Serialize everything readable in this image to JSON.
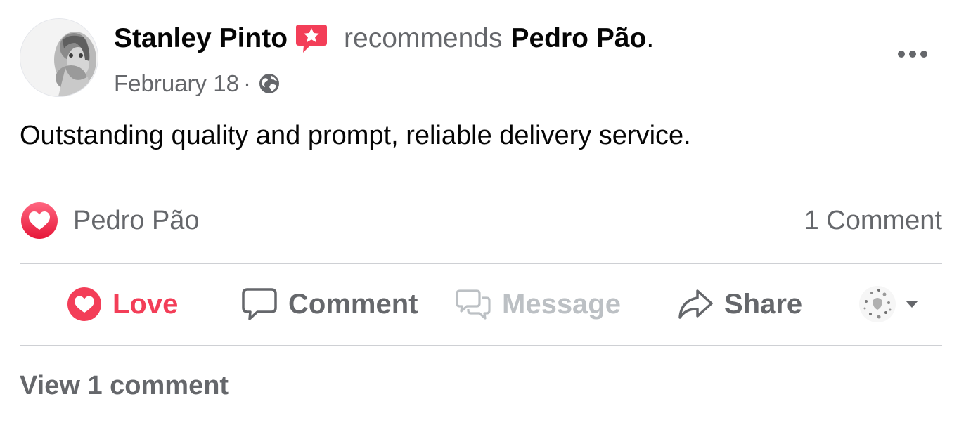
{
  "post": {
    "author": {
      "name": "Stanley Pinto",
      "avatar_icon": "profile-photo"
    },
    "recommendation": {
      "badge_icon": "recommendation-star-badge-icon",
      "badge_color": "#f33e58",
      "verb": "recommends",
      "page_name": "Pedro Pão",
      "punctuation": "."
    },
    "date": "February 18",
    "separator": "·",
    "audience_icon": "globe-icon",
    "more_icon": "more-options-icon",
    "text": "Outstanding quality and prompt, reliable delivery service."
  },
  "reactions": {
    "icon": "love-reaction-icon",
    "reactor": "Pedro Pão",
    "comment_count": "1 Comment"
  },
  "actions": [
    {
      "label": "Love",
      "icon": "heart-icon",
      "active": true,
      "color": "#f33e58"
    },
    {
      "label": "Comment",
      "icon": "comment-bubble-icon",
      "color": "#65676b"
    },
    {
      "label": "Message",
      "icon": "messenger-icon",
      "disabled": true,
      "color": "#bcc0c4"
    },
    {
      "label": "Share",
      "icon": "share-arrow-icon",
      "color": "#65676b"
    }
  ],
  "audience_selector": {
    "icon": "page-avatar-icon",
    "caret_icon": "caret-down-icon"
  },
  "view_comments": "View 1 comment",
  "colors": {
    "primary_text": "#050505",
    "secondary_text": "#65676b",
    "love_red": "#f33e58",
    "divider": "#ced0d4"
  }
}
